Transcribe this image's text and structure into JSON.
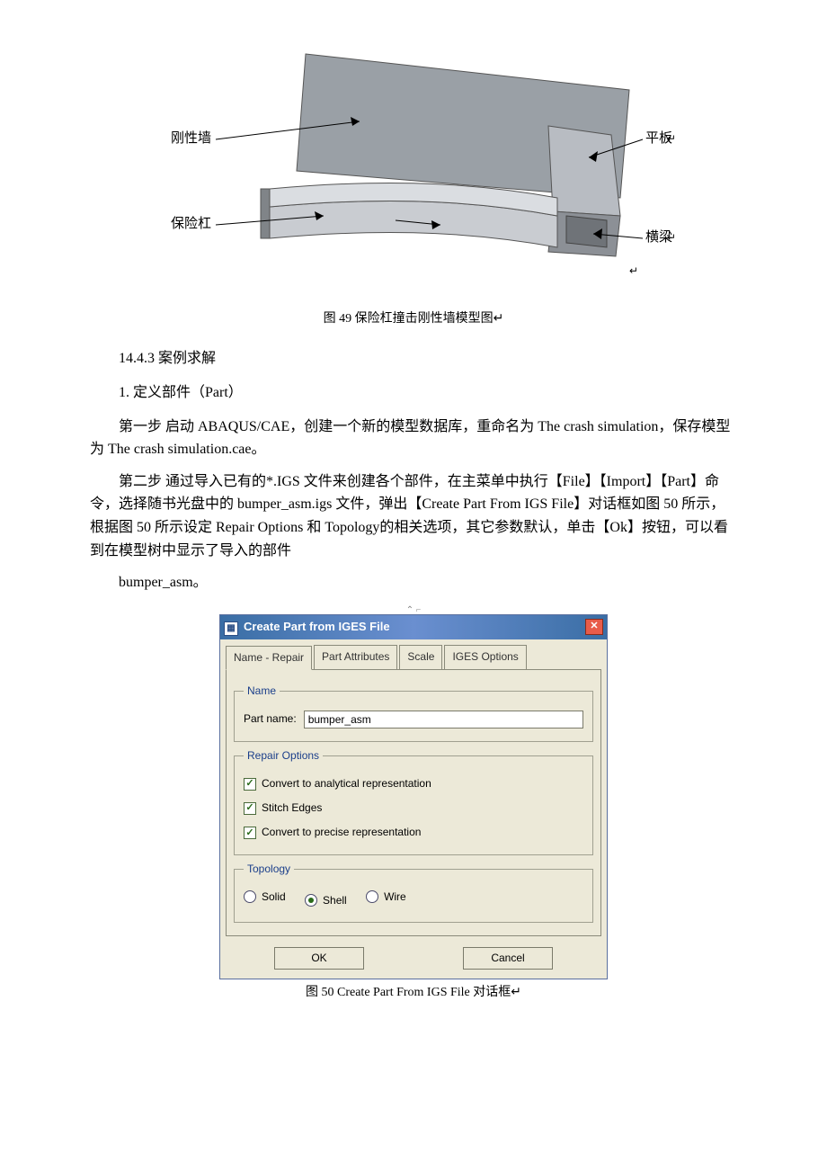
{
  "figure1": {
    "labels": {
      "rigidwall": "刚性墙",
      "bumper": "保险杠",
      "plate": "平板",
      "beam": "横梁"
    },
    "caption": "图 49    保险杠撞击刚性墙模型图"
  },
  "section": {
    "title": "14.4.3 案例求解",
    "subtitle": "1. 定义部件（Part）",
    "p1": "第一步 启动 ABAQUS/CAE，创建一个新的模型数据库，重命名为 The crash simulation，保存模型为 The crash simulation.cae。",
    "p2": "第二步 通过导入已有的*.IGS 文件来创建各个部件，在主菜单中执行【File】【Import】【Part】命令，选择随书光盘中的 bumper_asm.igs 文件，弹出【Create Part From IGS File】对话框如图 50 所示，根据图 50 所示设定 Repair Options 和 Topology的相关选项，其它参数默认，单击【Ok】按钮，可以看到在模型树中显示了导入的部件",
    "p3": "bumper_asm。"
  },
  "dialog": {
    "title": "Create Part from IGES File",
    "close": "✕",
    "tabs": [
      "Name - Repair",
      "Part Attributes",
      "Scale",
      "IGES Options"
    ],
    "nameGroup": "Name",
    "partNameLabel": "Part name:",
    "partNameValue": "bumper_asm",
    "repairGroup": "Repair Options",
    "repair": {
      "opt1": "Convert to analytical representation",
      "opt2": "Stitch Edges",
      "opt3": "Convert to precise representation"
    },
    "topologyGroup": "Topology",
    "topology": {
      "solid": "Solid",
      "shell": "Shell",
      "wire": "Wire"
    },
    "ok": "OK",
    "cancel": "Cancel"
  },
  "figure2": {
    "caption": "图 50    Create Part From IGS File 对话框"
  }
}
